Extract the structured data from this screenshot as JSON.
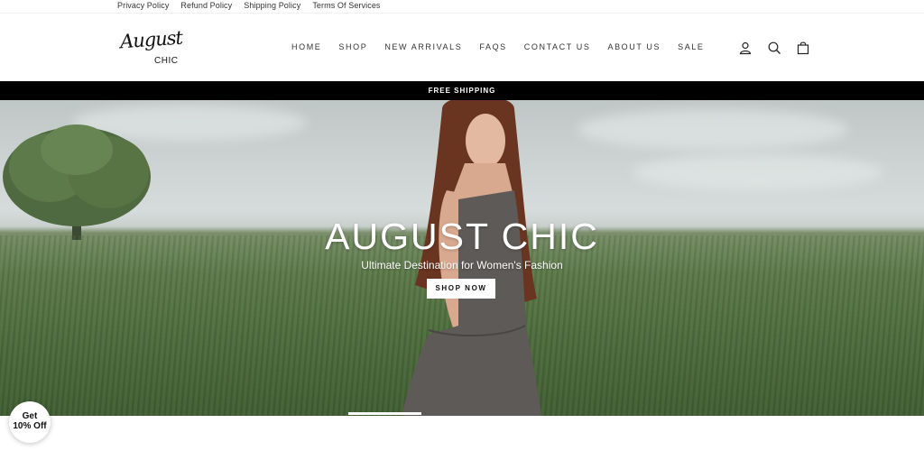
{
  "utility_bar": {
    "links": [
      "Privacy Policy",
      "Refund Policy",
      "Shipping Policy",
      "Terms Of Services"
    ]
  },
  "header": {
    "logo_script": "August",
    "logo_sub": "CHIC",
    "nav": [
      "HOME",
      "SHOP",
      "NEW ARRIVALS",
      "FAQS",
      "CONTACT US",
      "ABOUT US",
      "SALE"
    ],
    "icons": [
      "account-icon",
      "search-icon",
      "cart-icon"
    ]
  },
  "announcement": {
    "text": "FREE SHIPPING"
  },
  "hero": {
    "title": "AUGUST CHIC",
    "subtitle": "Ultimate Destination for Women's Fashion",
    "button_label": "SHOP NOW"
  },
  "promo_badge": {
    "line1": "Get",
    "line2": "10% Off"
  },
  "colors": {
    "announcement_bg": "#000000",
    "text": "#222222"
  }
}
